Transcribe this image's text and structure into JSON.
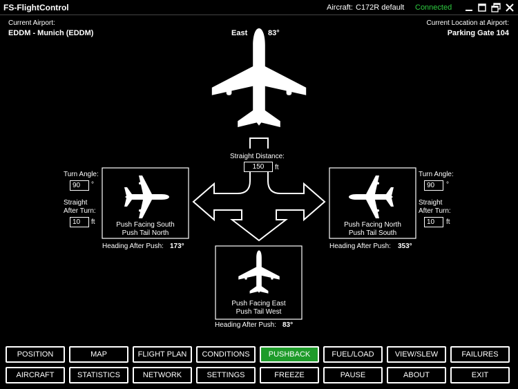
{
  "window": {
    "title": "FS-FlightControl",
    "aircraft_label": "Aircraft:",
    "aircraft_value": "C172R default",
    "connection_status": "Connected",
    "status_color": "#2ecc40"
  },
  "airport": {
    "current_label": "Current Airport:",
    "current_value": "EDDM - Munich (EDDM)",
    "location_label": "Current Location at Airport:",
    "location_value": "Parking Gate 104"
  },
  "aircraft_heading": {
    "direction": "East",
    "degrees": "83°"
  },
  "straight": {
    "label": "Straight Distance:",
    "value": "150",
    "unit": "ft"
  },
  "left_panel": {
    "turn_angle_label": "Turn Angle:",
    "turn_angle_value": "90",
    "turn_angle_unit": "°",
    "straight_after_label_1": "Straight",
    "straight_after_label_2": "After Turn:",
    "straight_after_value": "10",
    "straight_after_unit": "ft",
    "line1": "Push Facing South",
    "line2": "Push Tail North",
    "heading_label": "Heading After Push:",
    "heading_value": "173°"
  },
  "right_panel": {
    "turn_angle_label": "Turn Angle:",
    "turn_angle_value": "90",
    "turn_angle_unit": "°",
    "straight_after_label_1": "Straight",
    "straight_after_label_2": "After Turn:",
    "straight_after_value": "10",
    "straight_after_unit": "ft",
    "line1": "Push Facing North",
    "line2": "Push Tail South",
    "heading_label": "Heading After Push:",
    "heading_value": "353°"
  },
  "bottom_panel": {
    "line1": "Push Facing East",
    "line2": "Push Tail West",
    "heading_label": "Heading After Push:",
    "heading_value": "83°"
  },
  "nav": {
    "row1": [
      "POSITION",
      "MAP",
      "FLIGHT PLAN",
      "CONDITIONS",
      "PUSHBACK",
      "FUEL/LOAD",
      "VIEW/SLEW",
      "FAILURES"
    ],
    "row2": [
      "AIRCRAFT",
      "STATISTICS",
      "NETWORK",
      "SETTINGS",
      "FREEZE",
      "PAUSE",
      "ABOUT",
      "EXIT"
    ],
    "active": "PUSHBACK",
    "active_color": "#1e9b2a"
  }
}
